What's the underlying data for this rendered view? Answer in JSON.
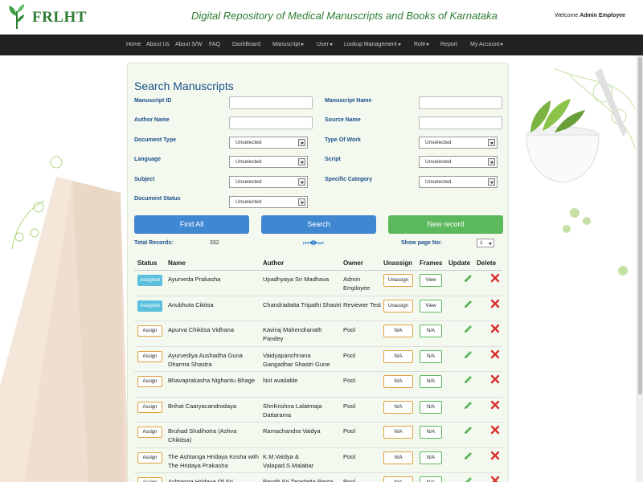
{
  "header": {
    "logo_text": "FRLHT",
    "site_title": "Digital Repository of Medical Manuscripts and Books of Karnataka",
    "welcome_prefix": "Welcome",
    "user_name": "Admin Employee"
  },
  "nav": [
    {
      "label": "Home",
      "dropdown": false
    },
    {
      "label": "About Us",
      "dropdown": false
    },
    {
      "label": "About S/W",
      "dropdown": false
    },
    {
      "label": "FAQ",
      "dropdown": false
    },
    {
      "label": "DashBoard",
      "dropdown": false
    },
    {
      "label": "Manuscript",
      "dropdown": true
    },
    {
      "label": "User",
      "dropdown": true
    },
    {
      "label": "Lookup Management",
      "dropdown": true
    },
    {
      "label": "Role",
      "dropdown": true
    },
    {
      "label": "Report",
      "dropdown": false
    },
    {
      "label": "My Account",
      "dropdown": true
    }
  ],
  "search": {
    "title": "Search Manuscripts",
    "fields": {
      "manuscript_id": {
        "label": "Manuscript ID",
        "value": ""
      },
      "manuscript_name": {
        "label": "Manuscript Name",
        "value": ""
      },
      "author_name": {
        "label": "Author Name",
        "value": ""
      },
      "source_name": {
        "label": "Source Name",
        "value": ""
      },
      "document_type": {
        "label": "Document Type",
        "value": "Unselected"
      },
      "type_of_work": {
        "label": "Type Of Work",
        "value": "Unselected"
      },
      "language": {
        "label": "Language",
        "value": "Unselected"
      },
      "script": {
        "label": "Script",
        "value": "Unselected"
      },
      "subject": {
        "label": "Subject",
        "value": "Unselected"
      },
      "specific_category": {
        "label": "Specific Category",
        "value": "Unselected"
      },
      "document_status": {
        "label": "Document Status",
        "value": "Unselected"
      }
    },
    "buttons": {
      "find_all": "Find All",
      "search": "Search",
      "new_record": "New record"
    }
  },
  "stats": {
    "total_label": "Total Records:",
    "total_value": "332",
    "pager_glyphs": "⏮◀▶⏭",
    "show_page_label": "Show page No:",
    "page_value": "1"
  },
  "table": {
    "headers": [
      "Status",
      "Name",
      "Author",
      "Owner",
      "Unassign",
      "Frames",
      "Update",
      "Delete"
    ],
    "rows": [
      {
        "status": "Assigned",
        "name": "Ayurveda Prakasha",
        "author": "Upadhyaya Sri Madhava",
        "owner": "Admin Employee",
        "unassign": "Unassign",
        "frames": "View"
      },
      {
        "status": "Assigned",
        "name": "Anubhuta Cikitsa",
        "author": "Chandradatta Tripathi Shastri",
        "owner": "Reviewer Test",
        "unassign": "Unassign",
        "frames": "View"
      },
      {
        "status": "Assign",
        "name": "Apurva Chikitsa Vidhana",
        "author": "Kaviraj Mahendranath Pandey",
        "owner": "Pool",
        "unassign": "N/A",
        "frames": "N/A"
      },
      {
        "status": "Assign",
        "name": "Ayurvediya Aushadha Guna Dharma Shastra",
        "author": "Vaidyapanchnana Gangadhar Shastri Gune",
        "owner": "Pool",
        "unassign": "N/A",
        "frames": "N/A"
      },
      {
        "status": "Assign",
        "name": "Bhavaprakasha Nighantu Bhage",
        "author": "Not available",
        "owner": "Pool",
        "unassign": "N/A",
        "frames": "N/A"
      },
      {
        "status": "Assign",
        "name": "Brihat Caaryacandrodaya",
        "author": "ShriKrishna Lalatmaja Dattarama",
        "owner": "Pool",
        "unassign": "N/A",
        "frames": "N/A"
      },
      {
        "status": "Assign",
        "name": "Bruhad Shalihotra (Ashva Chikitsa)",
        "author": "Ramachandra Vaidya",
        "owner": "Pool",
        "unassign": "N/A",
        "frames": "N/A"
      },
      {
        "status": "Assign",
        "name": "The Ashtanga Hridaya Kosha with The Hridaya Prakasha",
        "author": "K.M.Vaidya & Valapad.S.Malabar",
        "owner": "Pool",
        "unassign": "N/A",
        "frames": "N/A"
      },
      {
        "status": "Assign",
        "name": "Ashtanga Hridaya Of Sri",
        "author": "Pandit Sri Taradatta Panta",
        "owner": "Pool",
        "unassign": "N/A",
        "frames": "N/A"
      }
    ]
  }
}
